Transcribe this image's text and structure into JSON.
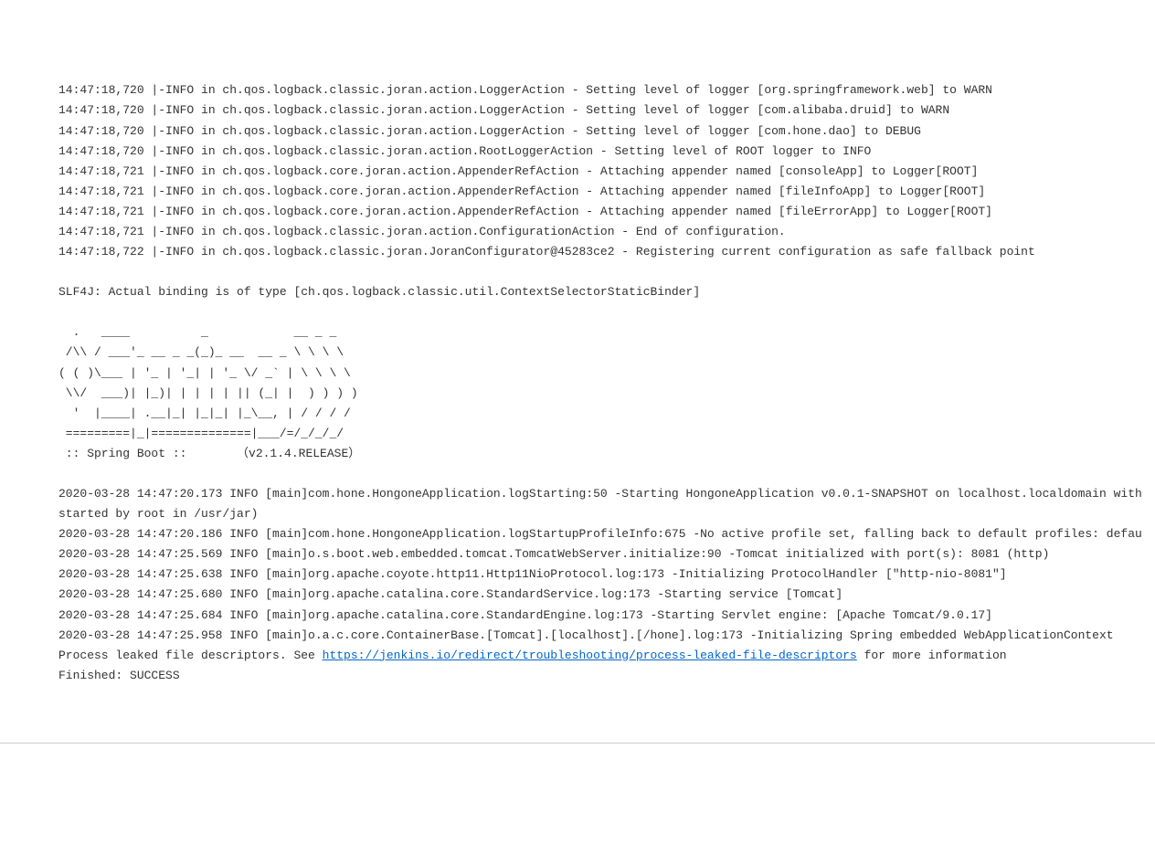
{
  "logback": [
    "14:47:18,720 |-INFO in ch.qos.logback.classic.joran.action.LoggerAction - Setting level of logger [org.springframework.web] to WARN",
    "14:47:18,720 |-INFO in ch.qos.logback.classic.joran.action.LoggerAction - Setting level of logger [com.alibaba.druid] to WARN",
    "14:47:18,720 |-INFO in ch.qos.logback.classic.joran.action.LoggerAction - Setting level of logger [com.hone.dao] to DEBUG",
    "14:47:18,720 |-INFO in ch.qos.logback.classic.joran.action.RootLoggerAction - Setting level of ROOT logger to INFO",
    "14:47:18,721 |-INFO in ch.qos.logback.core.joran.action.AppenderRefAction - Attaching appender named [consoleApp] to Logger[ROOT]",
    "14:47:18,721 |-INFO in ch.qos.logback.core.joran.action.AppenderRefAction - Attaching appender named [fileInfoApp] to Logger[ROOT]",
    "14:47:18,721 |-INFO in ch.qos.logback.core.joran.action.AppenderRefAction - Attaching appender named [fileErrorApp] to Logger[ROOT]",
    "14:47:18,721 |-INFO in ch.qos.logback.classic.joran.action.ConfigurationAction - End of configuration.",
    "14:47:18,722 |-INFO in ch.qos.logback.classic.joran.JoranConfigurator@45283ce2 - Registering current configuration as safe fallback point"
  ],
  "slf4j": "SLF4J: Actual binding is of type [ch.qos.logback.classic.util.ContextSelectorStaticBinder]",
  "banner": "  .   ____          _            __ _ _\n /\\\\ / ___'_ __ _ _(_)_ __  __ _ \\ \\ \\ \\\n( ( )\\___ | '_ | '_| | '_ \\/ _` | \\ \\ \\ \\\n \\\\/  ___)| |_)| | | | | || (_| |  ) ) ) )\n  '  |____| .__|_| |_|_| |_\\__, | / / / /\n =========|_|==============|___/=/_/_/_/\n :: Spring Boot ::       （v2.1.4.RELEASE）",
  "applog": [
    "2020-03-28 14:47:20.173 INFO [main]com.hone.HongoneApplication.logStarting:50 -Starting HongoneApplication v0.0.1-SNAPSHOT on localhost.localdomain with",
    "started by root in /usr/jar)",
    "2020-03-28 14:47:20.186 INFO [main]com.hone.HongoneApplication.logStartupProfileInfo:675 -No active profile set, falling back to default profiles: defau",
    "2020-03-28 14:47:25.569 INFO [main]o.s.boot.web.embedded.tomcat.TomcatWebServer.initialize:90 -Tomcat initialized with port(s): 8081 (http)",
    "2020-03-28 14:47:25.638 INFO [main]org.apache.coyote.http11.Http11NioProtocol.log:173 -Initializing ProtocolHandler [\"http-nio-8081\"]",
    "2020-03-28 14:47:25.680 INFO [main]org.apache.catalina.core.StandardService.log:173 -Starting service [Tomcat]",
    "2020-03-28 14:47:25.684 INFO [main]org.apache.catalina.core.StandardEngine.log:173 -Starting Servlet engine: [Apache Tomcat/9.0.17]",
    "2020-03-28 14:47:25.958 INFO [main]o.a.c.core.ContainerBase.[Tomcat].[localhost].[/hone].log:173 -Initializing Spring embedded WebApplicationContext"
  ],
  "leak": {
    "prefix": "Process leaked file descriptors. See ",
    "url": "https://jenkins.io/redirect/troubleshooting/process-leaked-file-descriptors",
    "suffix": " for more information"
  },
  "finished": "Finished: SUCCESS"
}
